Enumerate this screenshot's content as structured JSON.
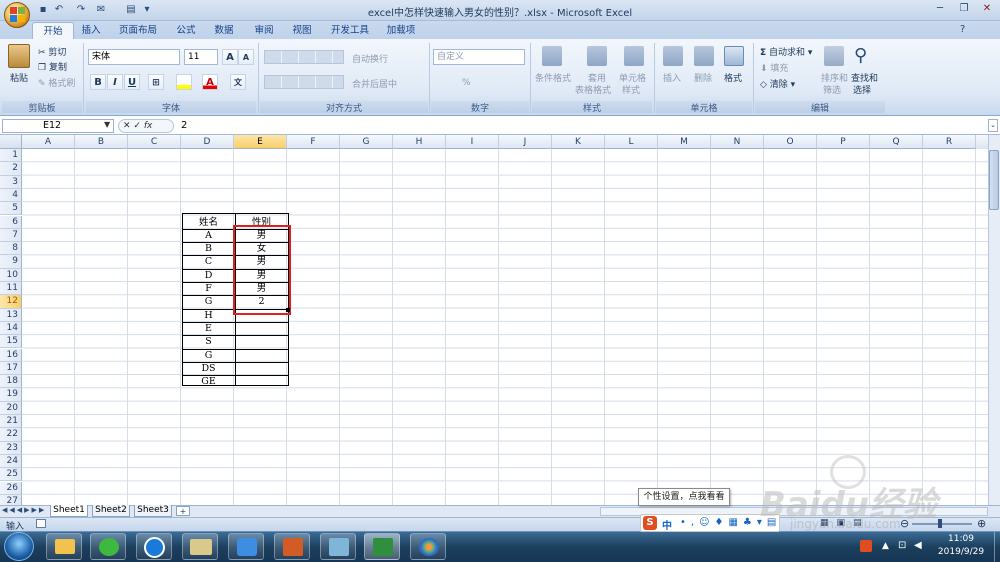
{
  "window": {
    "title": "excel中怎样快速输入男女的性别？.xlsx - Microsoft Excel"
  },
  "tabs": [
    "开始",
    "插入",
    "页面布局",
    "公式",
    "数据",
    "审阅",
    "视图",
    "开发工具",
    "加载项"
  ],
  "ribbon": {
    "clipboard": {
      "paste": "粘贴",
      "cut": "剪切",
      "copy": "复制",
      "format_painter": "格式刷",
      "label": "剪贴板"
    },
    "font": {
      "name": "宋体",
      "size": "11",
      "label": "字体",
      "bold": "B",
      "italic": "I",
      "underline": "U",
      "grow": "A",
      "shrink": "A"
    },
    "alignment": {
      "wrap": "自动换行",
      "merge": "合并后居中",
      "label": "对齐方式"
    },
    "number": {
      "format": "自定义",
      "label": "数字",
      "percent": "%"
    },
    "styles": {
      "cond": "条件格式",
      "table1": "套用",
      "table2": "表格格式",
      "cell1": "单元格",
      "cell2": "样式",
      "label": "样式"
    },
    "cells": {
      "insert": "插入",
      "delete": "删除",
      "format": "格式",
      "label": "单元格"
    },
    "editing": {
      "autosum": "自动求和",
      "fill": "填充",
      "clear": "清除",
      "sort1": "排序和",
      "sort2": "筛选",
      "find1": "查找和",
      "find2": "选择",
      "label": "编辑",
      "sigma": "Σ"
    }
  },
  "formula": {
    "cell_ref": "E12",
    "fx": "fx",
    "value": "2"
  },
  "columns": [
    "A",
    "B",
    "C",
    "D",
    "E",
    "F",
    "G",
    "H",
    "I",
    "J",
    "K",
    "L",
    "M",
    "N",
    "O",
    "P",
    "Q",
    "R"
  ],
  "rows": [
    "1",
    "2",
    "3",
    "4",
    "5",
    "6",
    "7",
    "8",
    "9",
    "10",
    "11",
    "12",
    "13",
    "14",
    "15",
    "16",
    "17",
    "18",
    "19",
    "20",
    "21",
    "22",
    "23",
    "24",
    "25",
    "26",
    "27"
  ],
  "table": {
    "headers": [
      "姓名",
      "性别"
    ],
    "names": [
      "A",
      "B",
      "C",
      "D",
      "F",
      "G",
      "H",
      "E",
      "S",
      "G",
      "DS",
      "GE"
    ],
    "genders": [
      "男",
      "女",
      "男",
      "男",
      "男",
      "2",
      "",
      "",
      "",
      "",
      "",
      ""
    ]
  },
  "sheets": [
    "Sheet1",
    "Sheet2",
    "Sheet3"
  ],
  "status": {
    "mode": "输入"
  },
  "tooltip": "个性设置，点我看看",
  "ime": {
    "lang": "中"
  },
  "watermark": {
    "brand": "Baidu经验",
    "url": "jingyan.baidu.com"
  },
  "clock": {
    "time": "11:09",
    "date": "2019/9/29"
  }
}
